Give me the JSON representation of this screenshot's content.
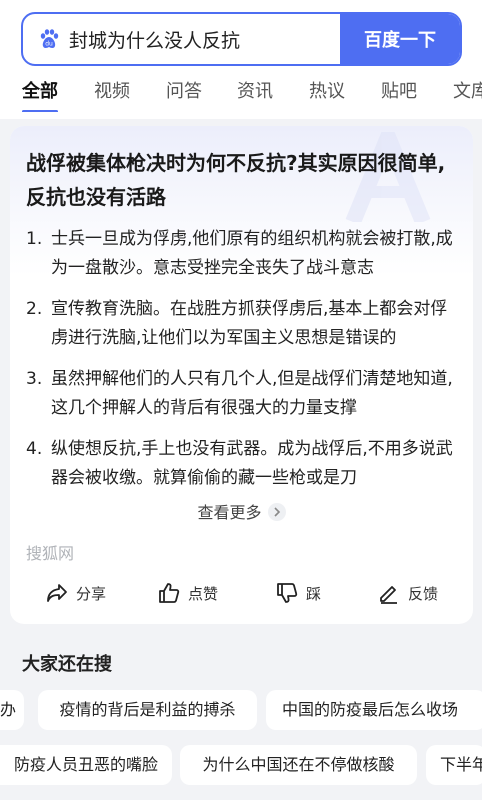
{
  "search": {
    "query": "封城为什么没人反抗",
    "button_label": "百度一下"
  },
  "tabs": [
    {
      "label": "全部",
      "active": true
    },
    {
      "label": "视频"
    },
    {
      "label": "问答"
    },
    {
      "label": "资讯"
    },
    {
      "label": "热议"
    },
    {
      "label": "贴吧"
    },
    {
      "label": "文库"
    }
  ],
  "card": {
    "title": "战俘被集体枪决时为何不反抗?其实原因很简单,反抗也没有活路",
    "items": [
      {
        "num": "1.",
        "text": "士兵一旦成为俘虏,他们原有的组织机构就会被打散,成为一盘散沙。意志受挫完全丧失了战斗意志"
      },
      {
        "num": "2.",
        "text": "宣传教育洗脑。在战胜方抓获俘虏后,基本上都会对俘虏进行洗脑,让他们以为军国主义思想是错误的"
      },
      {
        "num": "3.",
        "text": "虽然押解他们的人只有几个人,但是战俘们清楚地知道,这几个押解人的背后有很强大的力量支撑"
      },
      {
        "num": "4.",
        "text": "纵使想反抗,手上也没有武器。成为战俘后,不用多说武器会被收缴。就算偷偷的藏一些枪或是刀"
      }
    ],
    "more_label": "查看更多",
    "source": "搜狐网",
    "actions": {
      "share": "分享",
      "like": "点赞",
      "dislike": "踩",
      "feedback": "反馈"
    }
  },
  "related": {
    "title": "大家还在搜",
    "row1": [
      "办",
      "疫情的背后是利益的搏杀",
      "中国的防疫最后怎么收场"
    ],
    "row2": [
      "防疫人员丑恶的嘴脸",
      "为什么中国还在不停做核酸",
      "下半年"
    ]
  },
  "colors": {
    "accent": "#4e6ef2",
    "page_bg": "#f2f3f6"
  }
}
